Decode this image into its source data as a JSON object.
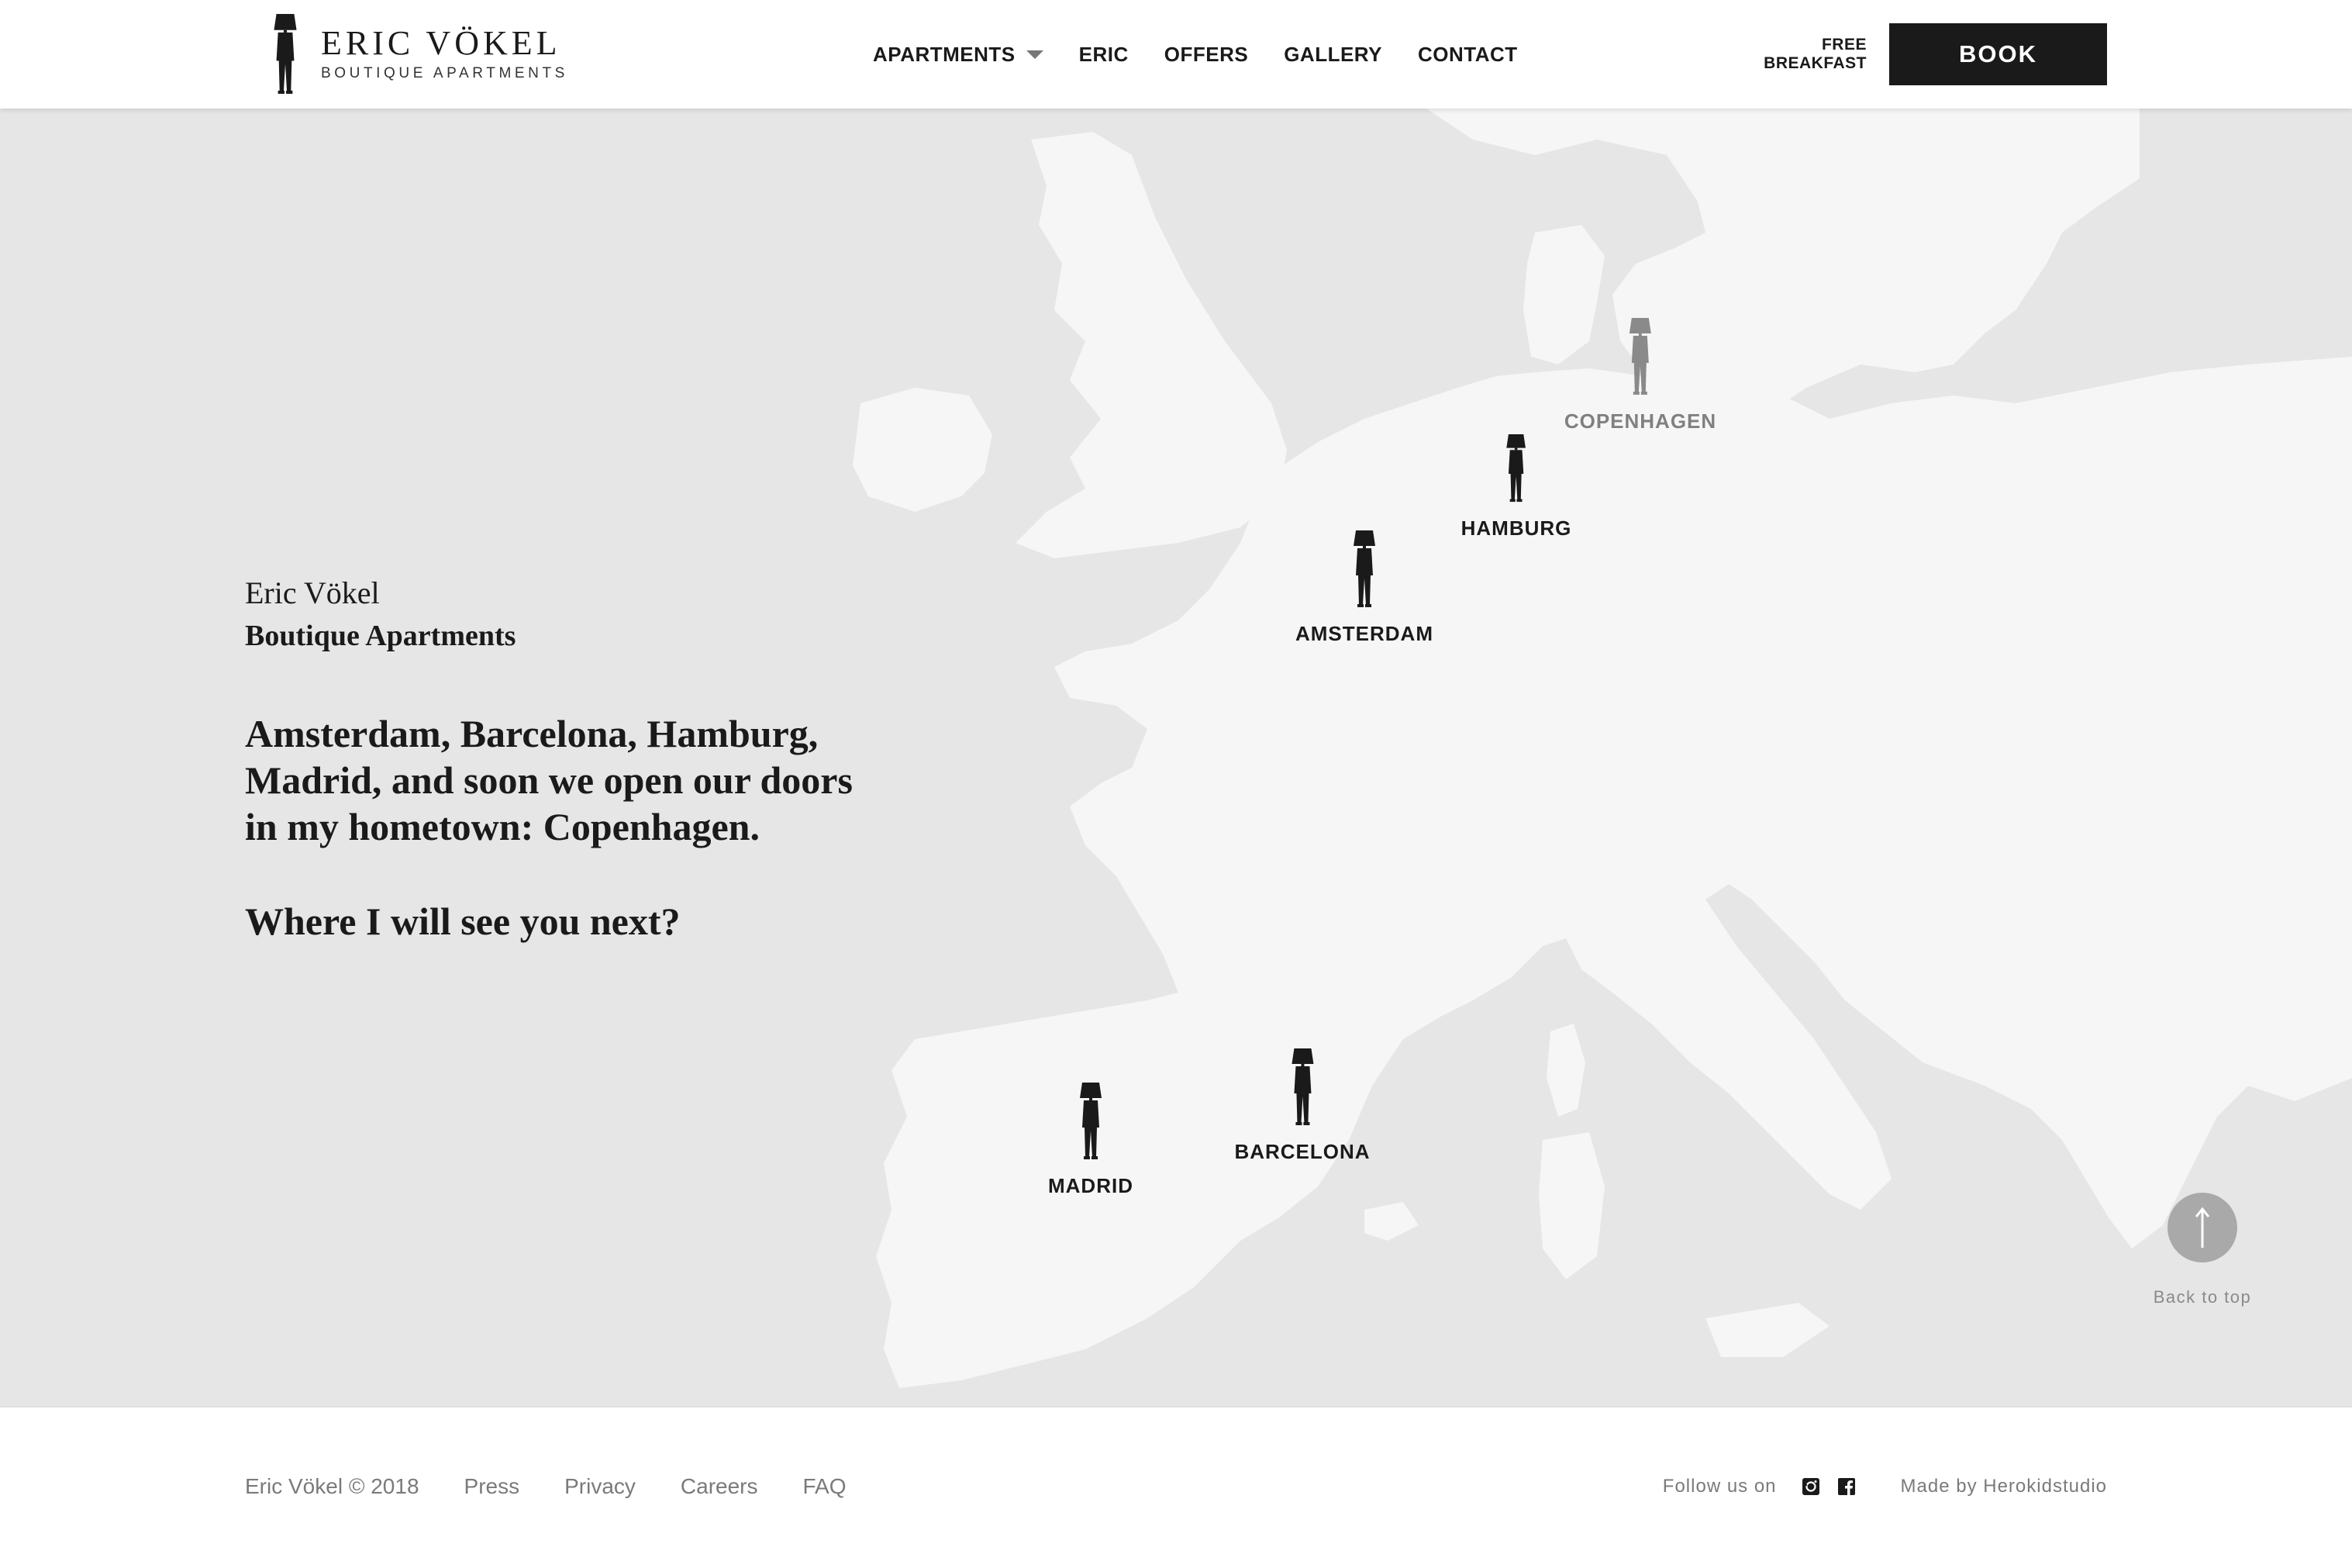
{
  "header": {
    "logo_title": "ERIC VÖKEL",
    "logo_subtitle": "BOUTIQUE APARTMENTS",
    "nav": [
      {
        "label": "APARTMENTS"
      },
      {
        "label": "ERIC"
      },
      {
        "label": "OFFERS"
      },
      {
        "label": "GALLERY"
      },
      {
        "label": "CONTACT"
      }
    ],
    "free_breakfast_line1": "FREE",
    "free_breakfast_line2": "BREAKFAST",
    "book_label": "BOOK"
  },
  "intro": {
    "name": "Eric Vökel",
    "subtitle": "Boutique Apartments",
    "body": "Amsterdam, Barcelona, Hamburg, Madrid, and soon we open our doors in my hometown: Copenhagen.",
    "question": "Where I will see you next?"
  },
  "map": {
    "markers": [
      {
        "label": "COPENHAGEN",
        "status": "soon"
      },
      {
        "label": "HAMBURG",
        "status": "open"
      },
      {
        "label": "AMSTERDAM",
        "status": "open"
      },
      {
        "label": "BARCELONA",
        "status": "open"
      },
      {
        "label": "MADRID",
        "status": "open"
      }
    ],
    "back_to_top": "Back to top"
  },
  "footer": {
    "copyright": "Eric Vökel © 2018",
    "links": [
      {
        "label": "Press"
      },
      {
        "label": "Privacy"
      },
      {
        "label": "Careers"
      },
      {
        "label": "FAQ"
      }
    ],
    "follow": "Follow us on",
    "social_icons": [
      "instagram-icon",
      "facebook-icon"
    ],
    "made_by": "Made by Herokidstudio"
  },
  "colors": {
    "sea": "#e6e6e6",
    "land": "#f6f6f6",
    "text": "#1a1a1a",
    "muted": "#7a7a7a",
    "book_bg": "#1a1a1a"
  }
}
